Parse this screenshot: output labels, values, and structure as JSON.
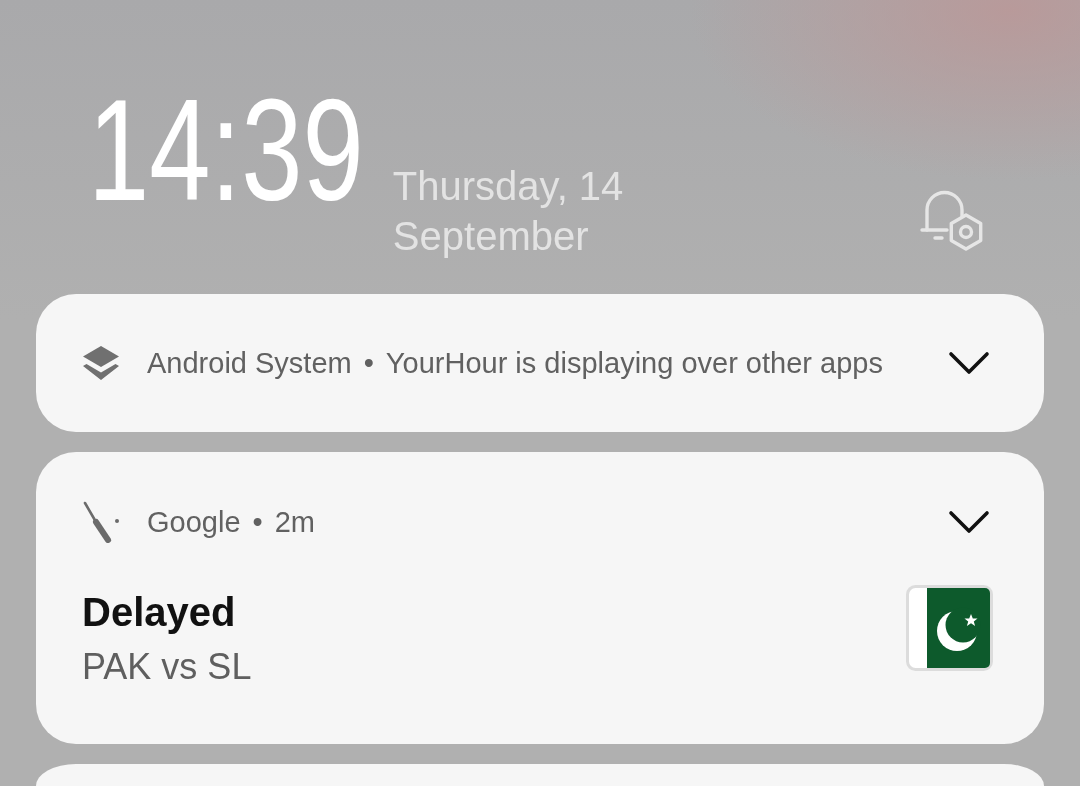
{
  "clock": {
    "time": "14:39",
    "date": "Thursday, 14 September"
  },
  "notifications": [
    {
      "kind": "system",
      "app": "Android System",
      "separator": "•",
      "text": "YourHour is displaying over other apps",
      "expanded": false
    },
    {
      "kind": "sports",
      "app": "Google",
      "separator": "•",
      "time": "2m",
      "title": "Delayed",
      "subtitle": "PAK vs SL",
      "expanded": false
    },
    {
      "kind": "partial"
    }
  ]
}
